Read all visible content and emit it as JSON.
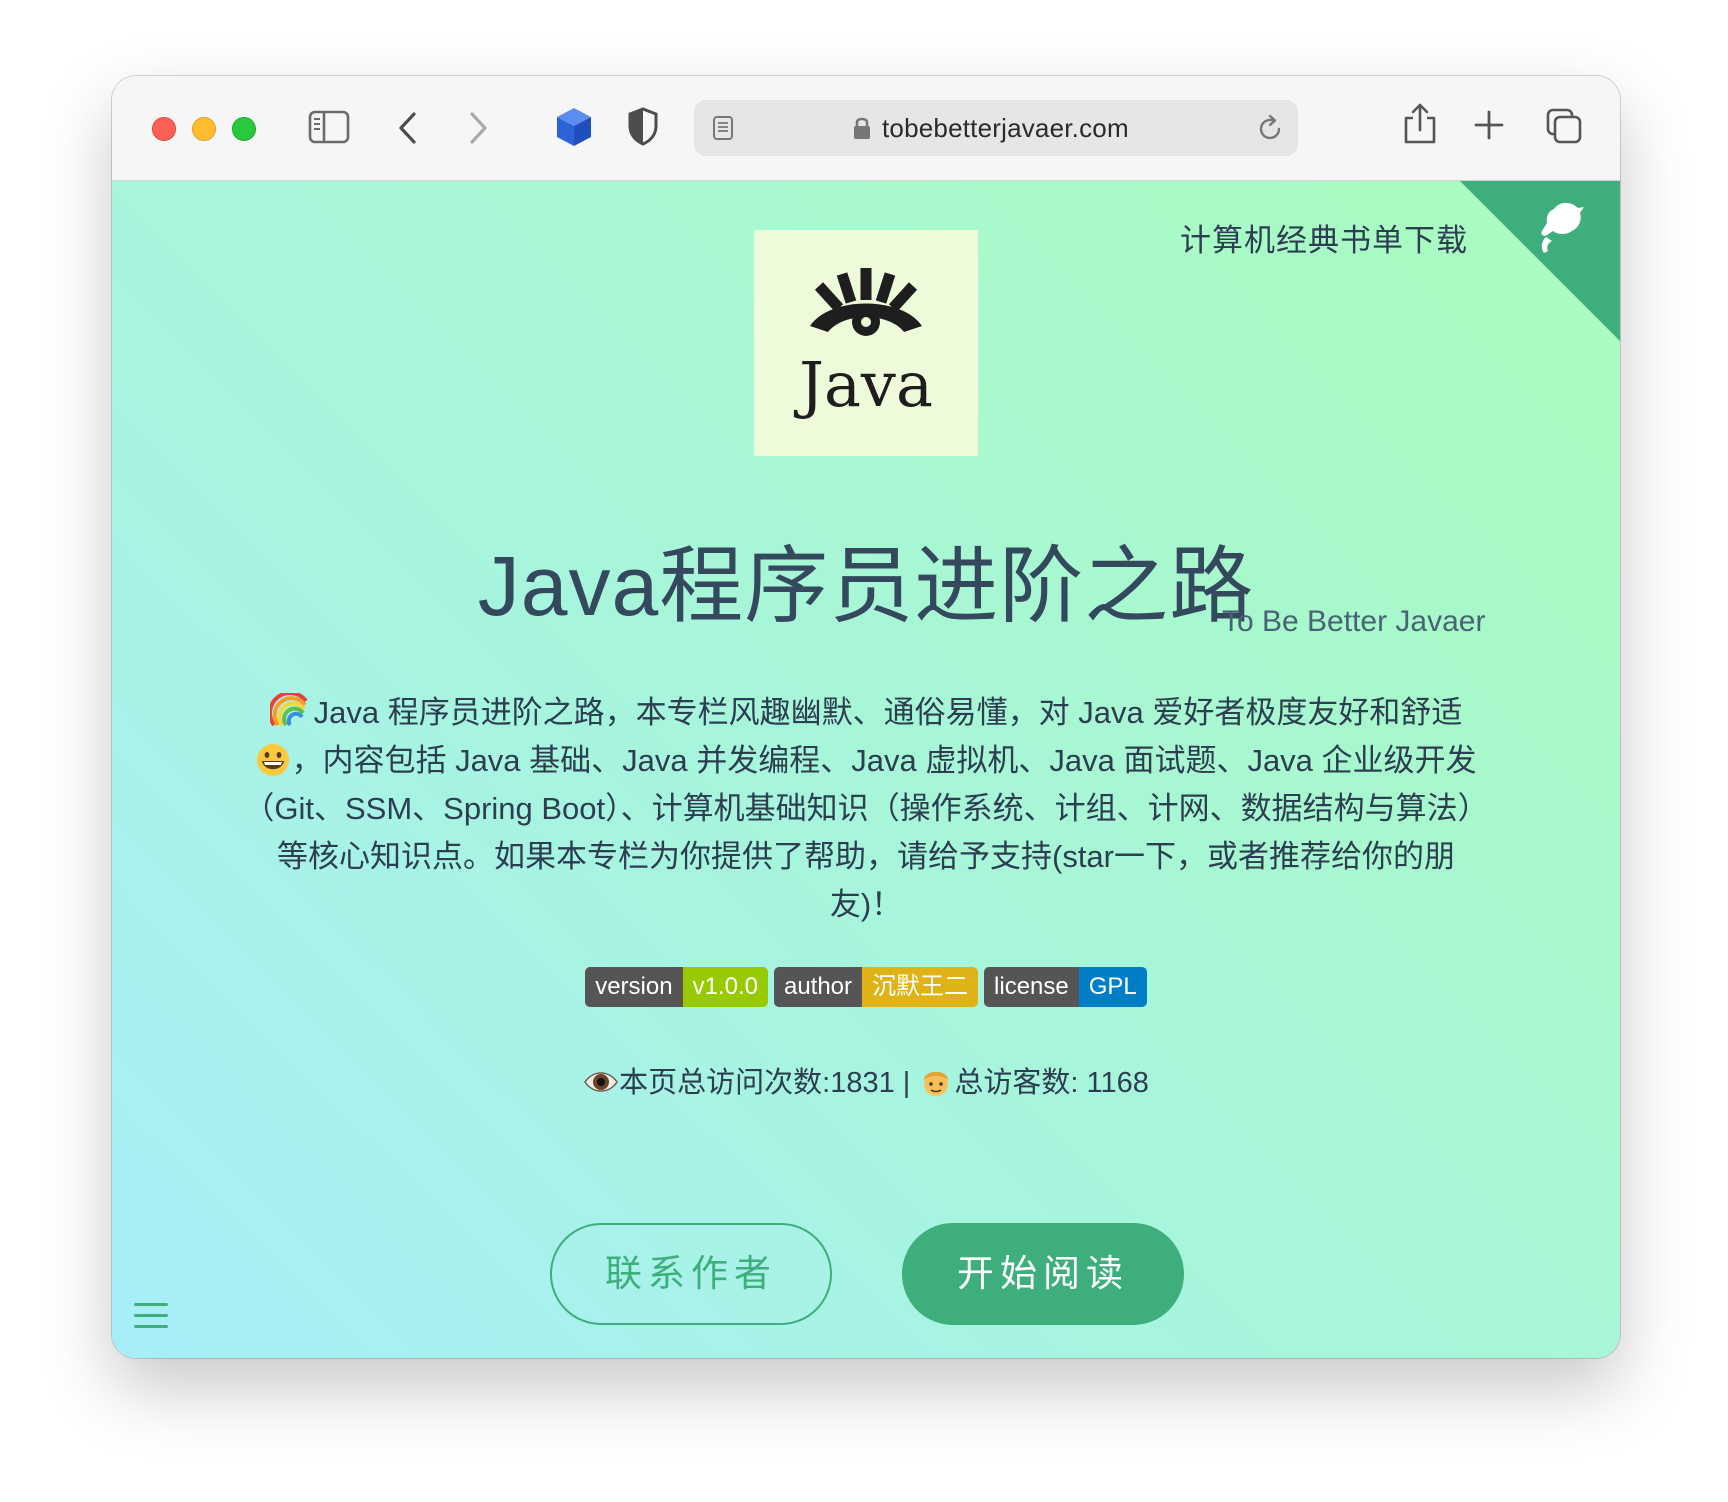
{
  "browser": {
    "url": "tobebetterjavaer.com"
  },
  "page": {
    "top_link": "计算机经典书单下载",
    "logo_text": "Java",
    "title": "Java程序员进阶之路",
    "subtitle": "To Be Better Javaer",
    "description_lines": [
      "Java 程序员进阶之路，本专栏风趣幽默、通俗易懂，对 Java 爱好者极度友好和舒适",
      "，内容包括 Java 基础、Java 并发编程、Java 虚拟机、Java 面试题、Java 企业级开发",
      "（Git、SSM、Spring Boot）、计算机基础知识（操作系统、计组、计网、数据结构与算法）",
      "等核心知识点。如果本专栏为你提供了帮助，请给予支持(star一下，或者推荐给你的朋",
      "友)！"
    ],
    "badges": [
      {
        "key": "version",
        "value": "v1.0.0",
        "color": "#97ca00"
      },
      {
        "key": "author",
        "value": "沉默王二",
        "color": "#dfb317"
      },
      {
        "key": "license",
        "value": "GPL",
        "color": "#007ec6"
      }
    ],
    "stats": {
      "page_views_label": "本页总访问次数:1831 |",
      "visitors_label": "总访客数: 1168"
    },
    "buttons": {
      "contact": "联系作者",
      "start": "开始阅读"
    },
    "accent_color": "#3eaf7c",
    "icons": [
      "sidebar-icon",
      "back-icon",
      "forward-icon",
      "extension-cube-icon",
      "shield-icon",
      "reader-icon",
      "lock-icon",
      "reload-icon",
      "share-icon",
      "new-tab-icon",
      "tabs-overview-icon",
      "github-corner-icon",
      "menu-icon"
    ]
  }
}
